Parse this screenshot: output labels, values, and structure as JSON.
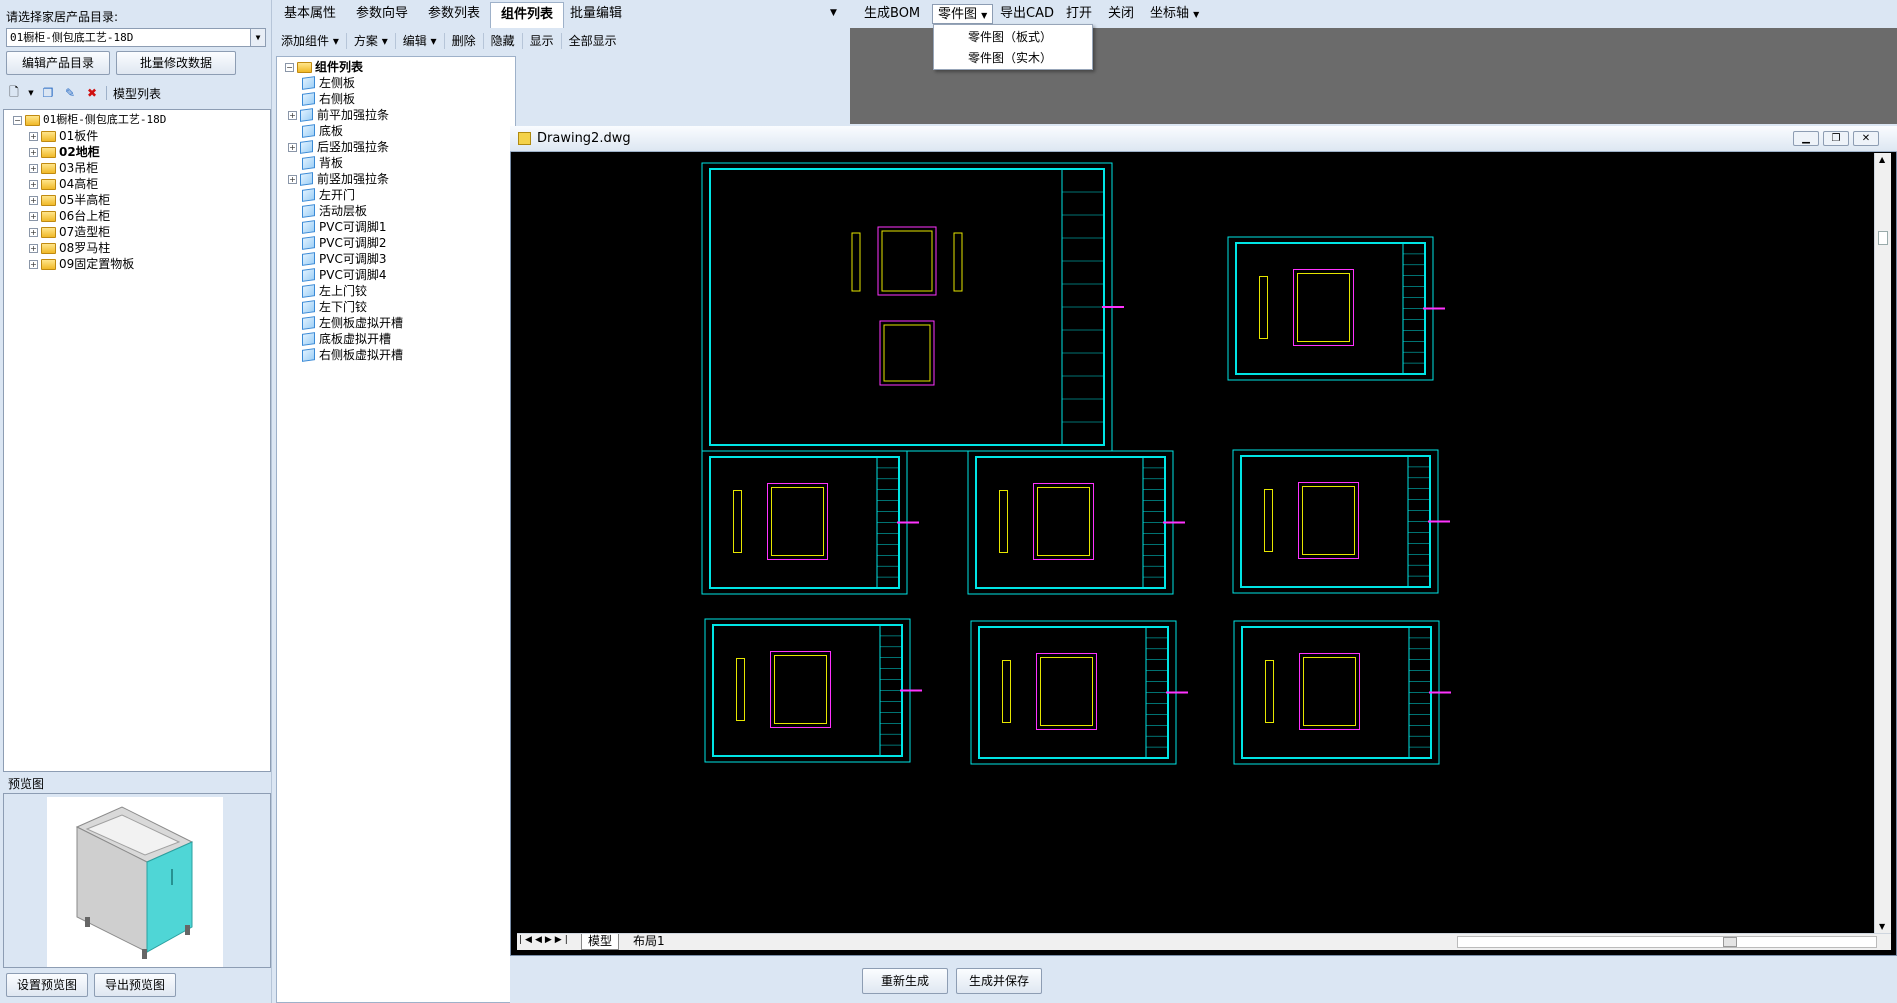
{
  "left": {
    "catalog_label": "请选择家居产品目录:",
    "catalog_value": "01橱柜-侧包底工艺-18D",
    "edit_catalog_btn": "编辑产品目录",
    "batch_edit_btn": "批量修改数据",
    "model_list_label": "模型列表",
    "tree_root": "01橱柜-侧包底工艺-18D",
    "tree_items": [
      "01板件",
      "02地柜",
      "03吊柜",
      "04高柜",
      "05半高柜",
      "06台上柜",
      "07造型柜",
      "08罗马柱",
      "09固定置物板"
    ],
    "preview_label": "预览图",
    "set_preview_btn": "设置预览图",
    "export_preview_btn": "导出预览图"
  },
  "mid": {
    "tabs": [
      "基本属性",
      "参数向导",
      "参数列表",
      "组件列表",
      "批量编辑"
    ],
    "toolbar": [
      "添加组件",
      "方案",
      "编辑",
      "删除",
      "隐藏",
      "显示",
      "全部显示"
    ],
    "tree_root": "组件列表",
    "components": [
      "左侧板",
      "右侧板",
      "前平加强拉条",
      "底板",
      "后竖加强拉条",
      "背板",
      "前竖加强拉条",
      "左开门",
      "活动层板",
      "PVC可调脚1",
      "PVC可调脚2",
      "PVC可调脚3",
      "PVC可调脚4",
      "左上门铰",
      "左下门铰",
      "左侧板虚拟开槽",
      "底板虚拟开槽",
      "右侧板虚拟开槽"
    ]
  },
  "right": {
    "toolbar": [
      "生成BOM",
      "零件图",
      "导出CAD",
      "打开",
      "关闭",
      "坐标轴"
    ],
    "dropdown": [
      "零件图（板式）",
      "零件图（实木）"
    ],
    "cad_title": "Drawing2.dwg",
    "layout_tabs": [
      "模型",
      "布局1"
    ],
    "regen_btn": "重新生成",
    "gen_save_btn": "生成并保存"
  }
}
